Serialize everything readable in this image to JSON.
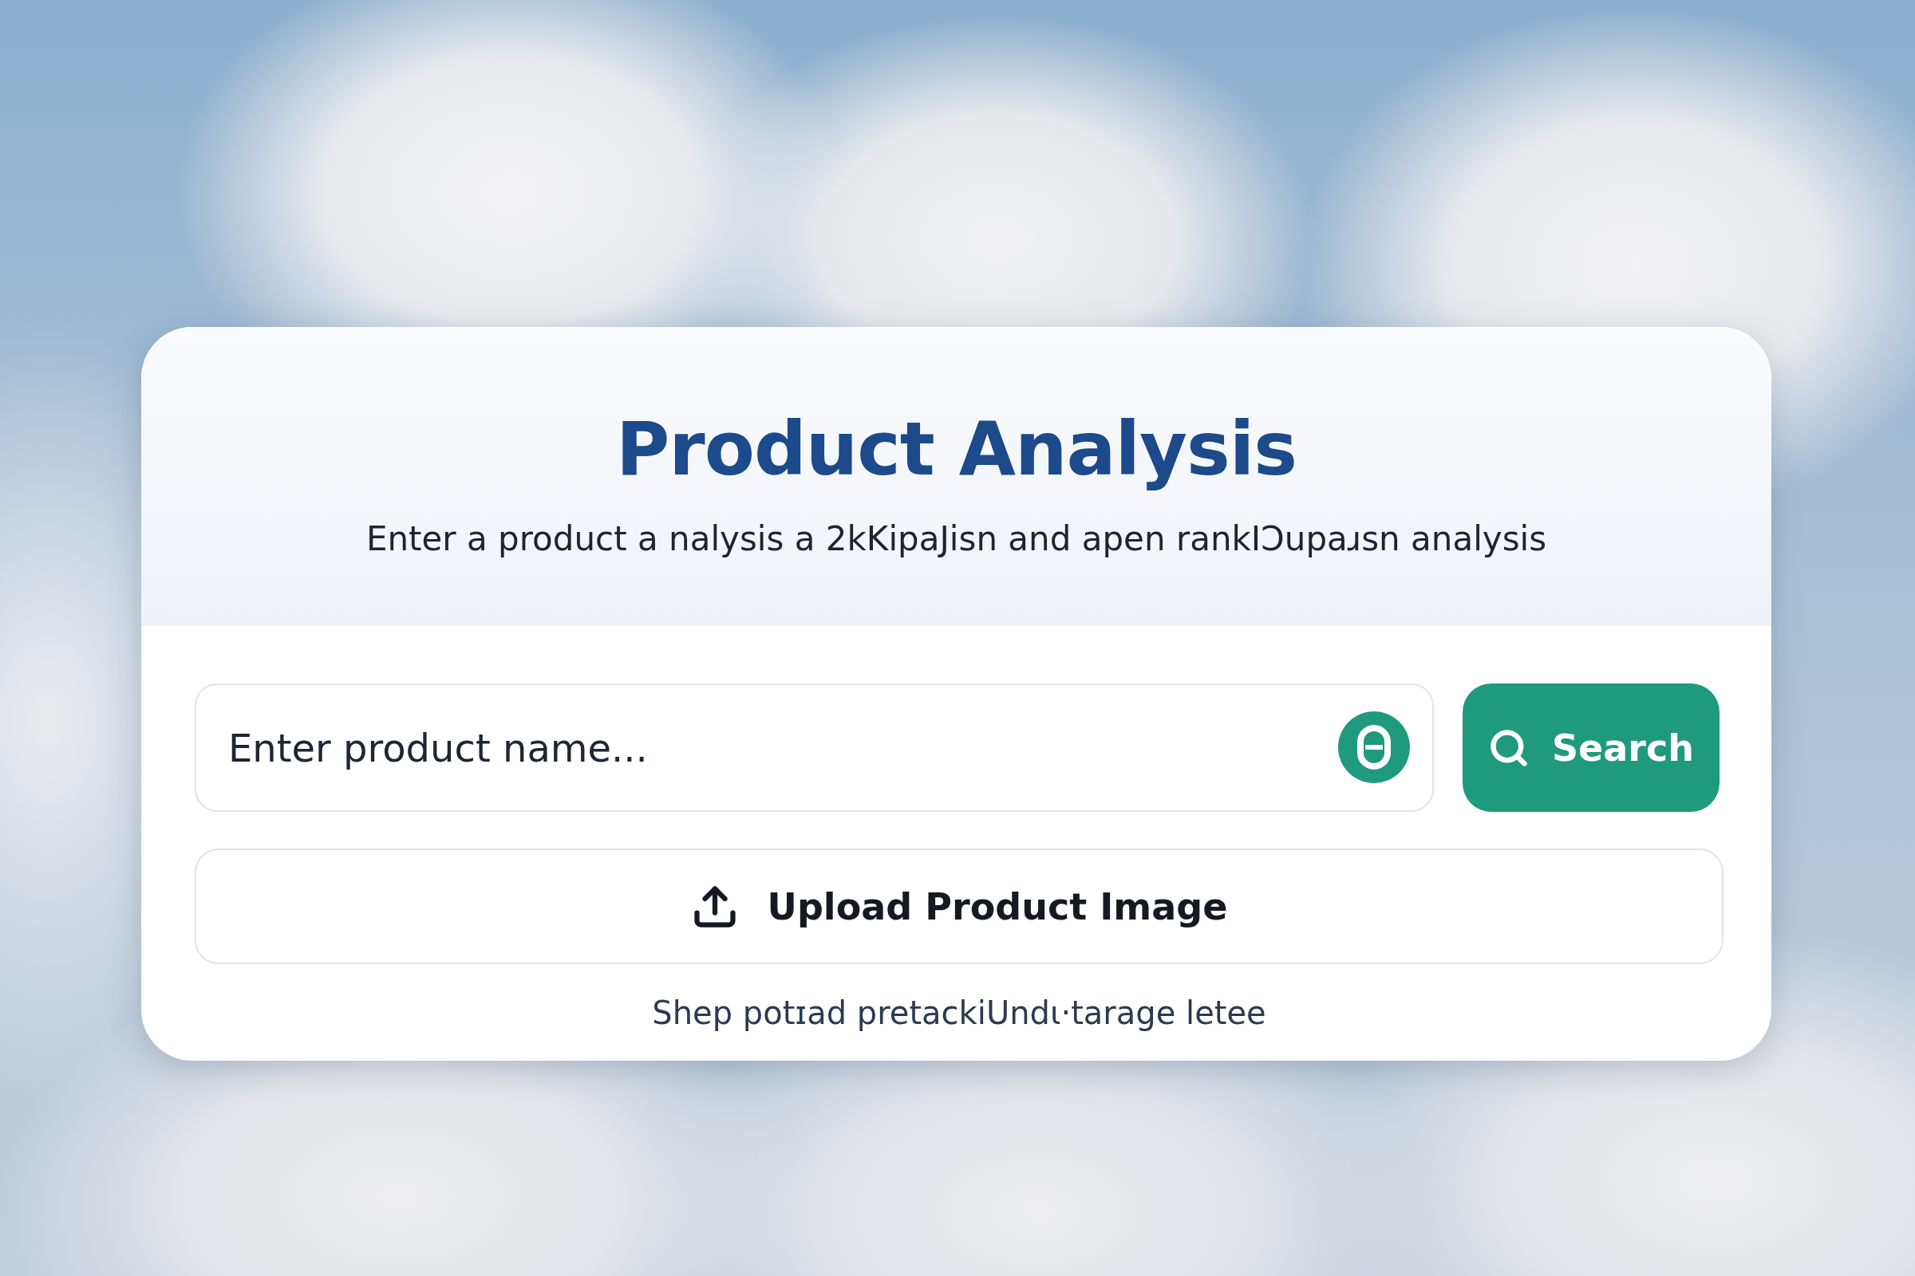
{
  "card": {
    "title": "Product Analysis",
    "subtitle": "Enter a product a nalysis a 2kKipaJisn and apen rankIↃupaɹsn analysis"
  },
  "search": {
    "placeholder": "Enter product name...",
    "button": "Search"
  },
  "upload": {
    "label": "Upload Product Image"
  },
  "hint": "Shep potɪad pretackiUndɩ·tarage letee"
}
